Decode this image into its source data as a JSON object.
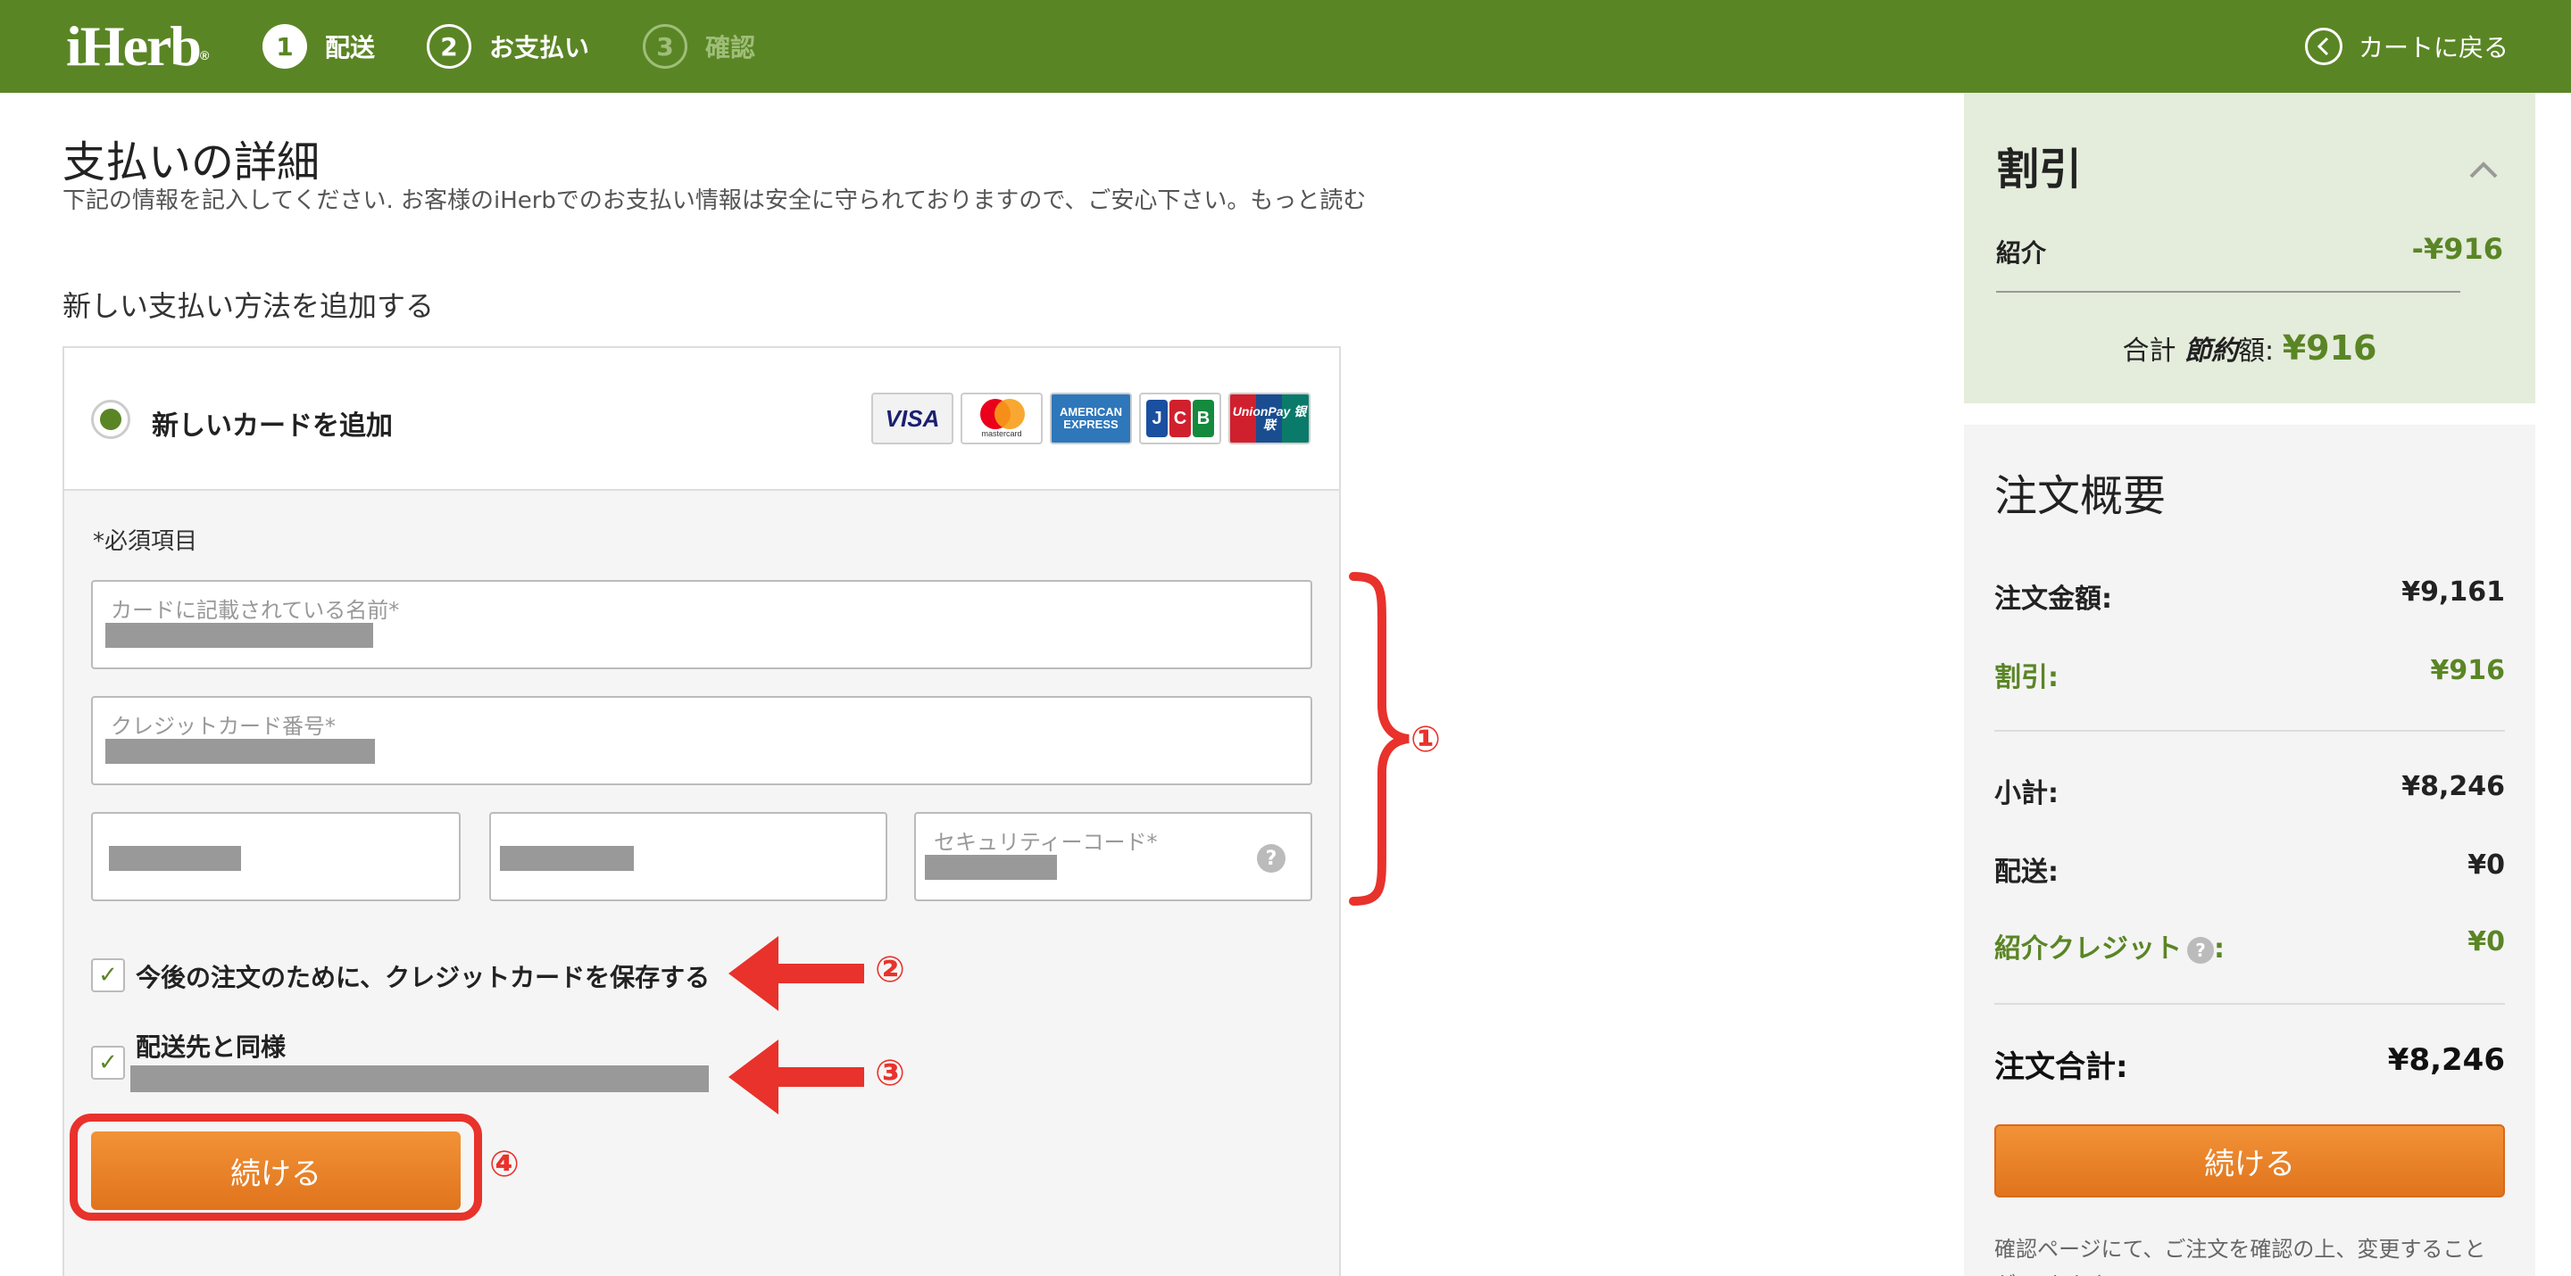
{
  "header": {
    "logo": "iHerb",
    "logo_mark": "®",
    "steps": [
      {
        "num": "1",
        "label": "配送"
      },
      {
        "num": "2",
        "label": "お支払い"
      },
      {
        "num": "3",
        "label": "確認"
      }
    ],
    "back_to_cart": "カートに戻る",
    "icons": {
      "back": "chevron-left-circle-icon"
    }
  },
  "main": {
    "title": "支払いの詳細",
    "description": "下記の情報を記入してください. お客様のiHerbでのお支払い情報は安全に守られておりますので、ご安心下さい。もっと読む",
    "section_title": "新しい支払い方法を追加する",
    "add_card_label": "新しいカードを追加",
    "card_brands": [
      "VISA",
      "mastercard",
      "AMERICAN EXPRESS",
      "JCB",
      "UnionPay 银联"
    ],
    "required_note": "*必須項目",
    "fields": {
      "name_placeholder": "カードに記載されている名前*",
      "number_placeholder": "クレジットカード番号*",
      "cvv_placeholder": "セキュリティーコード*"
    },
    "save_card_label": "今後の注文のために、クレジットカードを保存する",
    "same_as_shipping_label": "配送先と同様",
    "continue_label": "続ける",
    "annotations": [
      "①",
      "②",
      "③",
      "④"
    ],
    "colors": {
      "brand_green": "#5a8525",
      "orange": "#e8852a",
      "annotation_red": "#e8322b"
    }
  },
  "discount": {
    "title": "割引",
    "row_label": "紹介",
    "row_value": "-¥916",
    "total_prefix": "合計",
    "total_italic": "節約",
    "total_suffix": "額:",
    "total_value": "¥916"
  },
  "summary": {
    "title": "注文概要",
    "order_amount_label": "注文金額:",
    "order_amount_value": "¥9,161",
    "discount_label": "割引:",
    "discount_value": "¥916",
    "subtotal_label": "小計:",
    "subtotal_value": "¥8,246",
    "shipping_label": "配送:",
    "shipping_value": "¥0",
    "referral_credit_label": "紹介クレジット",
    "referral_credit_suffix": ":",
    "referral_credit_value": "¥0",
    "total_label": "注文合計:",
    "total_value": "¥8,246",
    "continue_label": "続ける",
    "note": "確認ページにて、ご注文を確認の上、変更することが できます。"
  }
}
